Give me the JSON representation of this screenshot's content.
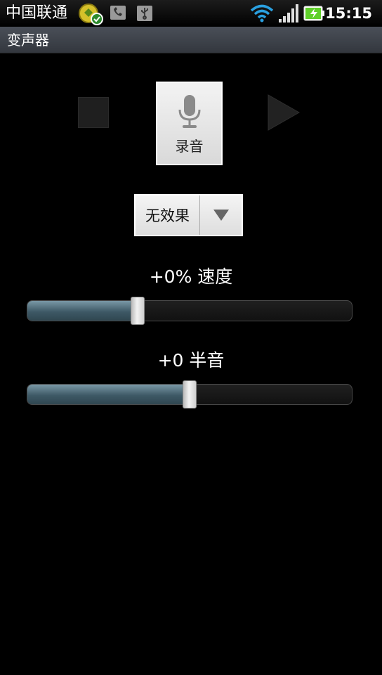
{
  "status_bar": {
    "carrier": "中国联通",
    "time": "15:15",
    "icons": [
      "app-notification-icon",
      "phone-notification-icon",
      "usb-icon",
      "wifi-icon",
      "signal-icon",
      "battery-charging-icon"
    ]
  },
  "title_bar": {
    "title": "变声器"
  },
  "controls": {
    "record_label": "录音",
    "icons": [
      "stop-icon",
      "microphone-icon",
      "play-icon"
    ]
  },
  "effect": {
    "selected": "无效果"
  },
  "speed": {
    "label": "+0% 速度",
    "value_fraction": 0.34
  },
  "pitch": {
    "label": "+0 半音",
    "value_fraction": 0.5
  },
  "colors": {
    "background": "#000000",
    "slider_fill": "#3e5966",
    "wifi": "#2aa0e0",
    "battery": "#5fd02a"
  }
}
